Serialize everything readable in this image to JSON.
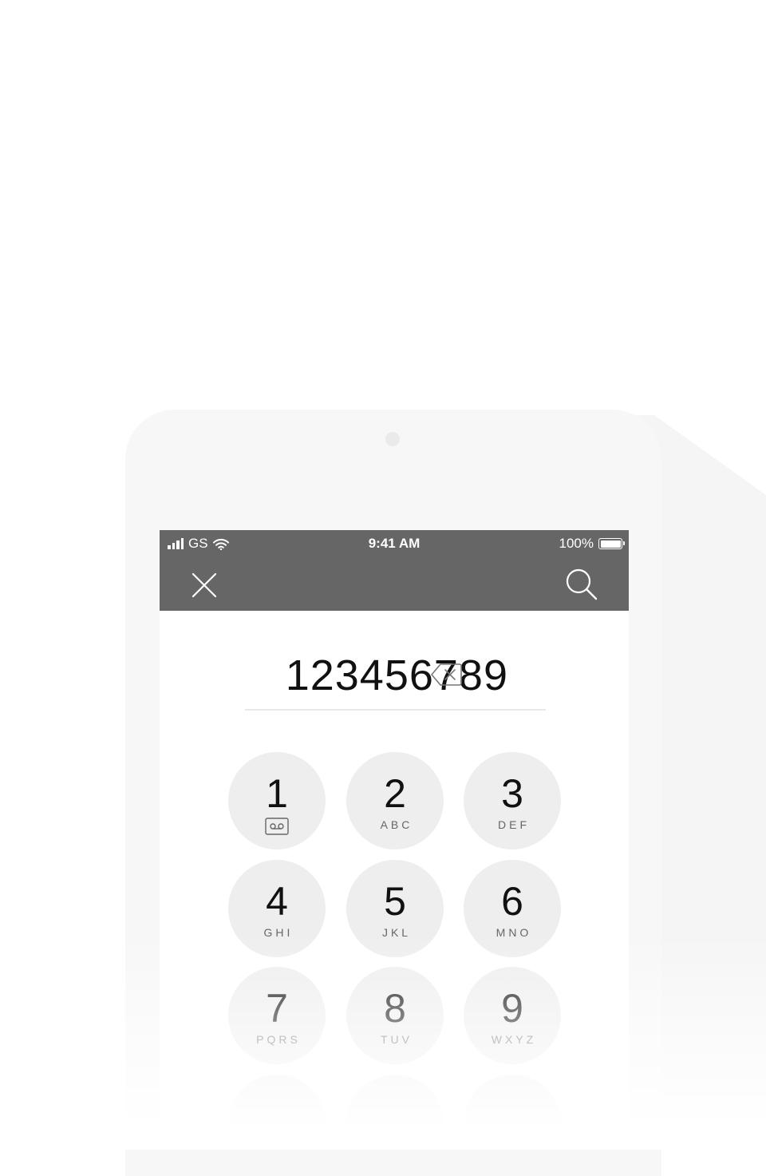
{
  "status_bar": {
    "carrier": "GS",
    "time": "9:41 AM",
    "battery": "100%",
    "battery_level": 1.0,
    "icons": [
      "signal-icon",
      "wifi-icon",
      "battery-icon"
    ]
  },
  "nav": {
    "close_icon": "close-icon",
    "search_icon": "search-icon"
  },
  "dialer": {
    "number": "123456789",
    "backspace_icon": "backspace-icon"
  },
  "keypad": {
    "keys": [
      {
        "digit": "1",
        "letters": "",
        "icon": "voicemail-icon"
      },
      {
        "digit": "2",
        "letters": "ABC"
      },
      {
        "digit": "3",
        "letters": "DEF"
      },
      {
        "digit": "4",
        "letters": "GHI"
      },
      {
        "digit": "5",
        "letters": "JKL"
      },
      {
        "digit": "6",
        "letters": "MNO"
      },
      {
        "digit": "7",
        "letters": "PQRS"
      },
      {
        "digit": "8",
        "letters": "TUV"
      },
      {
        "digit": "9",
        "letters": "WXYZ"
      }
    ]
  },
  "colors": {
    "header": "#666666",
    "key_background": "#eeeeee",
    "phone_body": "#f7f7f7"
  }
}
